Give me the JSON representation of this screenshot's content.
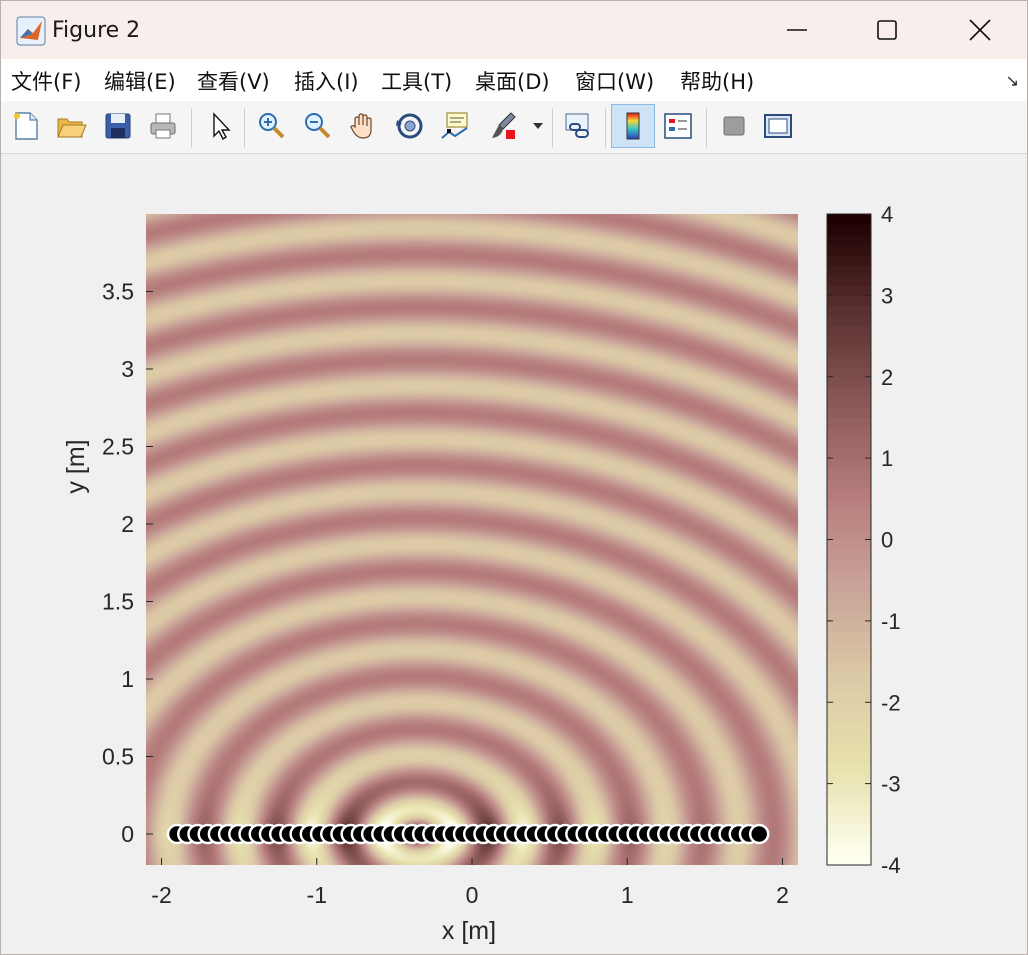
{
  "window": {
    "title": "Figure 2",
    "icon": "matlab-icon",
    "controls": [
      "minimize-icon",
      "maximize-icon",
      "close-icon"
    ]
  },
  "menu": {
    "items": [
      "文件(F)",
      "编辑(E)",
      "查看(V)",
      "插入(I)",
      "工具(T)",
      "桌面(D)",
      "窗口(W)",
      "帮助(H)"
    ],
    "corner_glyph": "↘"
  },
  "toolbar": {
    "buttons": [
      "new-figure-icon",
      "open-file-icon",
      "save-icon",
      "print-icon",
      "edit-plot-pointer-icon",
      "zoom-in-icon",
      "zoom-out-icon",
      "pan-hand-icon",
      "rotate-3d-icon",
      "data-cursor-icon",
      "brush-icon",
      "brush-dropdown-icon",
      "link-plot-icon",
      "insert-colorbar-icon",
      "insert-legend-icon",
      "hide-plot-tools-icon",
      "show-plot-tools-icon"
    ],
    "active": "insert-colorbar-icon"
  },
  "chart_data": {
    "type": "heatmap",
    "description_free": true,
    "xlabel": "x [m]",
    "ylabel": "y [m]",
    "xlim": [
      -2.1,
      2.1
    ],
    "ylim": [
      -0.2,
      4.0
    ],
    "xticks": [
      -2,
      -1,
      0,
      1,
      2
    ],
    "yticks": [
      0,
      0.5,
      1,
      1.5,
      2,
      2.5,
      3,
      3.5
    ],
    "colorbar": {
      "limits": [
        -4,
        4
      ],
      "ticks": [
        4,
        3,
        2,
        1,
        0,
        -1,
        -2,
        -3,
        -4
      ]
    },
    "colormap": [
      "#fffff0",
      "#e7e2ae",
      "#dcc9a6",
      "#c9a398",
      "#b67c7c",
      "#8a5858",
      "#5a3030",
      "#1e0000"
    ],
    "source_markers": {
      "y": 0,
      "x_start": -1.9,
      "x_end": 1.85,
      "count": 58,
      "color": "#000000",
      "edge": "#ffffff"
    }
  }
}
